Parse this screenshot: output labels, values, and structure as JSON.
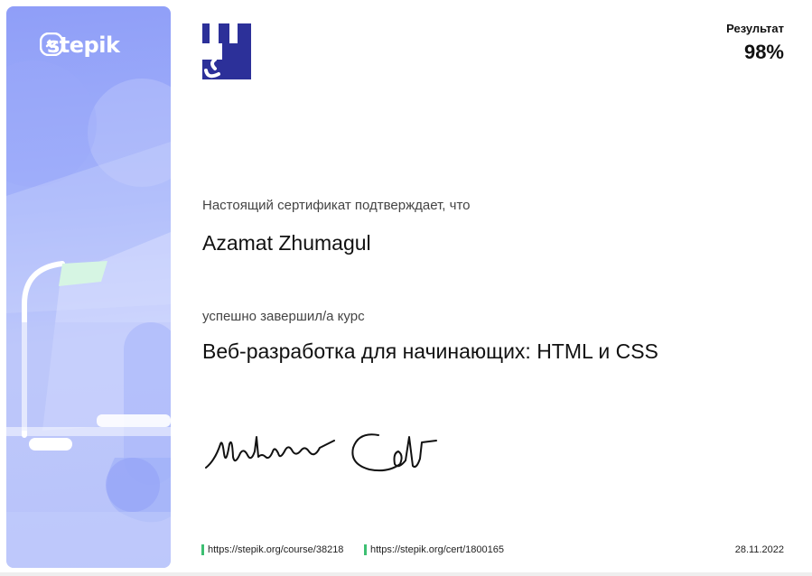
{
  "brand": {
    "name": "stepik",
    "icon": "stepik-logo-icon"
  },
  "course_logo": {
    "letter": "c",
    "colors": [
      "#2c3099",
      "#ffffff"
    ]
  },
  "result": {
    "label": "Результат",
    "value": "98%"
  },
  "certificate": {
    "confirm_text": "Настоящий сертификат подтверждает, что",
    "recipient_name": "Azamat Zhumagul",
    "completed_text": "успешно завершил/а  курс",
    "course_title": "Веб-разработка для начинающих: HTML и CSS"
  },
  "signatures": [
    {
      "name": "signature-1",
      "type": "handwritten"
    },
    {
      "name": "signature-2",
      "type": "handwritten"
    }
  ],
  "footer": {
    "course_url": "https://stepik.org/course/38218",
    "cert_url": "https://stepik.org/cert/1800165",
    "date": "28.11.2022",
    "accent_color": "#3dbf72"
  },
  "colors": {
    "panel_top": "#8f9ef8",
    "panel_bottom": "#b7c2fa",
    "text": "#111111"
  }
}
